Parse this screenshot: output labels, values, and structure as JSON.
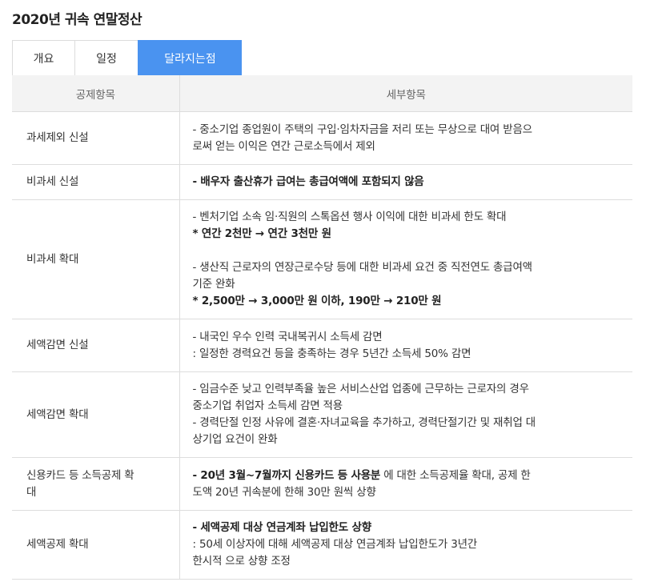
{
  "page": {
    "title": "2020년 귀속 연말정산"
  },
  "tabs": [
    {
      "label": "개요"
    },
    {
      "label": "일정"
    },
    {
      "label": "달라지는점"
    }
  ],
  "table": {
    "headers": {
      "category": "공제항목",
      "detail": "세부항목"
    },
    "rows": [
      {
        "category": "과세제외 신설",
        "lines": [
          "- 중소기업 종업원이 주택의 구입·임차자금을 저리 또는 무상으로 대여 받음으",
          "로써 얻는 이익은 연간 근로소득에서 제외"
        ]
      },
      {
        "category": "비과세 신설",
        "lines": [
          "- 배우자 출산휴가 급여는 총급여액에 포함되지 않음"
        ]
      },
      {
        "category": "비과세 확대",
        "lines": [
          "- 벤처기업 소속 임·직원의 스톡옵션 행사 이익에 대한 비과세 한도 확대",
          "* 연간 2천만 → 연간 3천만 원",
          "- 생산직 근로자의 연장근로수당 등에 대한 비과세 요건 중 직전연도 총급여액",
          "기준 완화",
          "* 2,500만 → 3,000만 원 이하, 190만 → 210만 원"
        ]
      },
      {
        "category": "세액감면 신설",
        "lines": [
          "- 내국인 우수 인력 국내복귀시 소득세 감면",
          ": 일정한 경력요건 등을 충족하는 경우 5년간 소득세 50% 감면"
        ]
      },
      {
        "category": "세액감면 확대",
        "lines": [
          "- 임금수준 낮고 인력부족율 높은 서비스산업 업종에 근무하는 근로자의 경우",
          "중소기업 취업자 소득세 감면 적용",
          "- 경력단절 인정 사유에 결혼·자녀교육을 추가하고, 경력단절기간 및 재취업 대",
          "상기업 요건이 완화"
        ]
      },
      {
        "category_lines": [
          "신용카드 등 소득공제 확",
          "대"
        ],
        "bold_part": "- 20년 3월~7월까지 신용카드 등 사용분",
        "rest_part": " 에 대한 소득공제율 확대, 공제 한",
        "line2": "도액 20년 귀속분에 한해 30만 원씩 상향"
      },
      {
        "category": "세액공제 확대",
        "lines": [
          "- 세액공제 대상 연금계좌 납입한도 상향",
          ": 50세 이상자에 대해 세액공제 대상 연금계좌 납입한도가 3년간",
          "한시적 으로 상향 조정"
        ]
      }
    ]
  }
}
